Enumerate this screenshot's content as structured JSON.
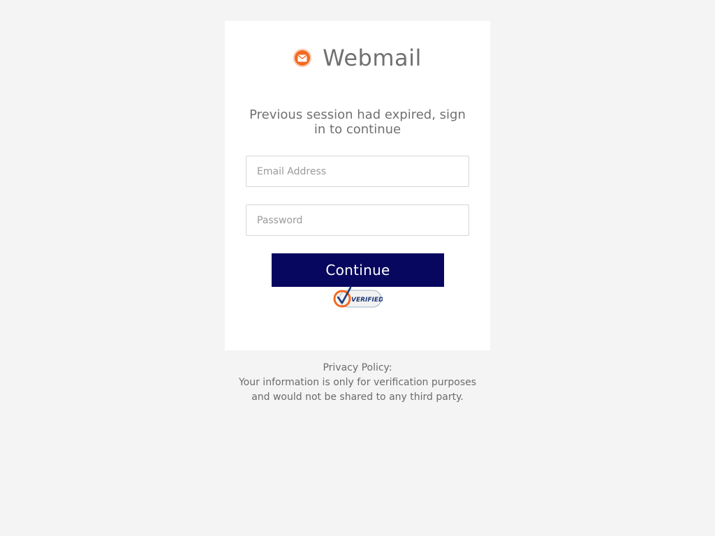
{
  "brand": {
    "title": "Webmail",
    "icon": "envelope-icon",
    "accent": "#f26a21"
  },
  "form": {
    "message": "Previous session had expired, sign in to continue",
    "email_placeholder": "Email Address",
    "email_value": "",
    "password_placeholder": "Password",
    "password_value": "",
    "submit_label": "Continue",
    "submit_color": "#07075f",
    "badge_text": "VERIFIED",
    "badge_icon": "checkmark-icon"
  },
  "footer": {
    "privacy_heading": "Privacy Policy:",
    "privacy_line1": "Your information is only for verification purposes",
    "privacy_line2": "and would not be shared to any third party."
  }
}
